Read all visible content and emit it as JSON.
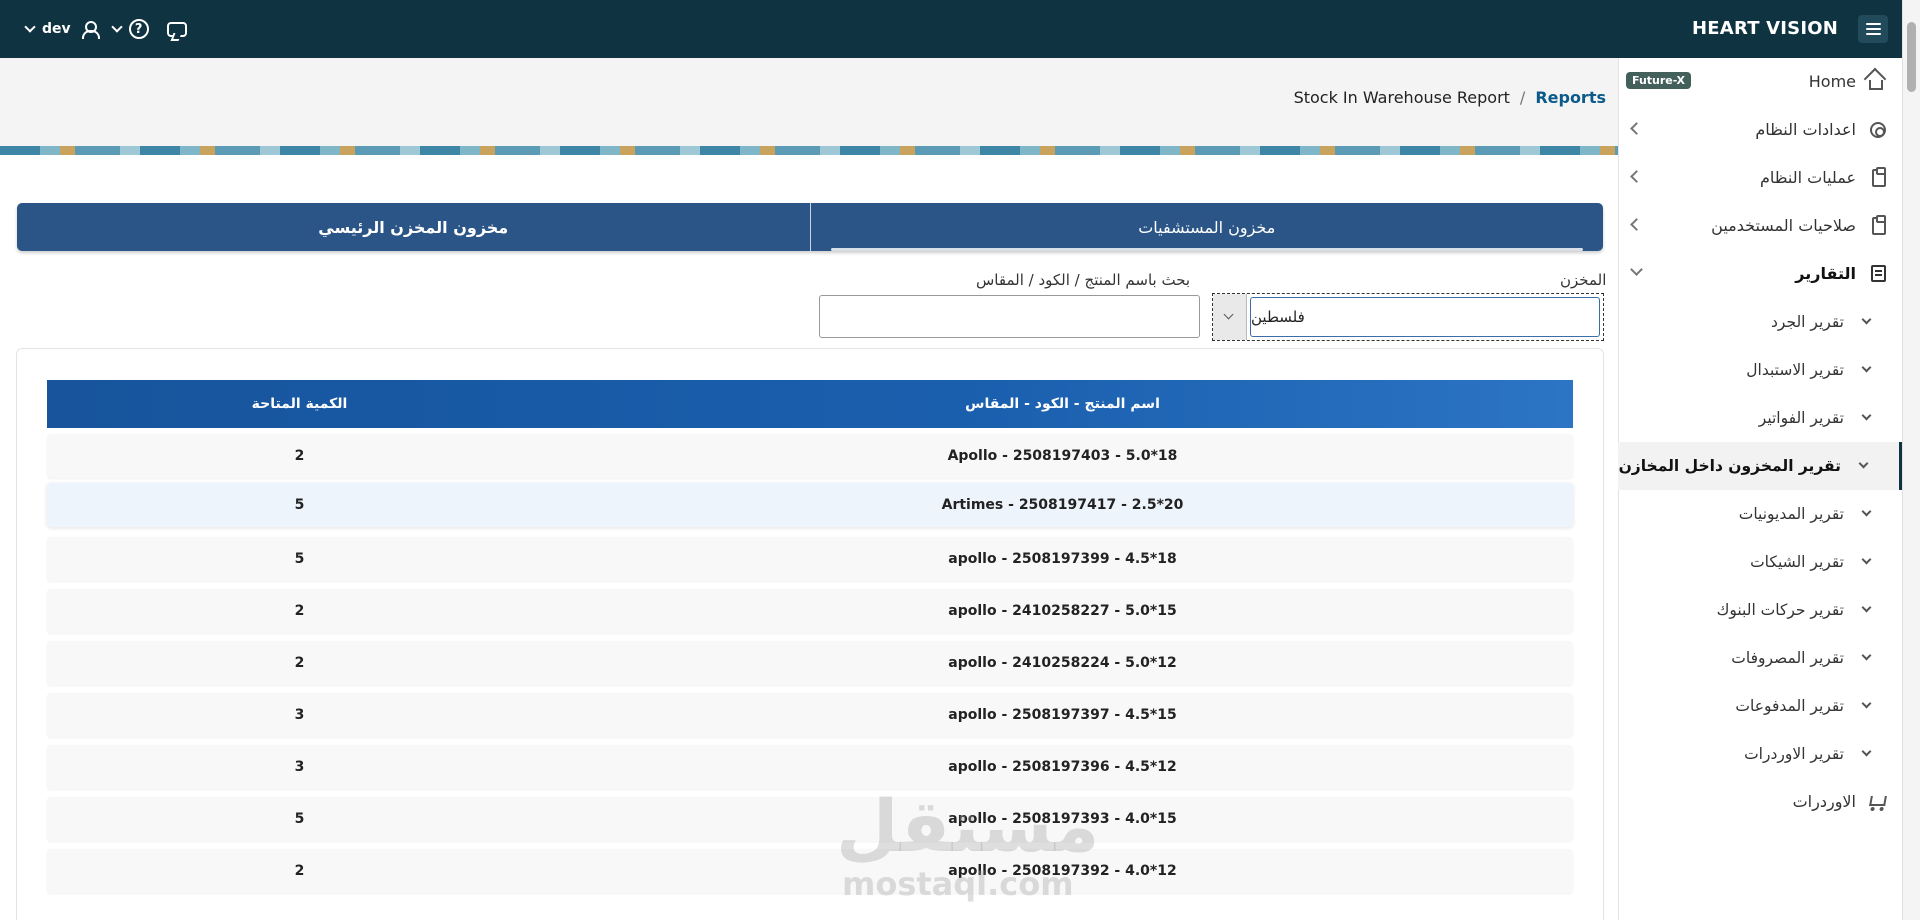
{
  "topbar": {
    "brand": "HEART VISION",
    "user": "dev"
  },
  "breadcrumb": {
    "current": "Stock In Warehouse Report",
    "separator": "/",
    "parent": "Reports"
  },
  "sidebar": {
    "badge": "Future-X",
    "items": [
      {
        "label": "Home",
        "icon": "home-icon"
      },
      {
        "label": "اعدادات النظام",
        "icon": "gear-icon"
      },
      {
        "label": "عمليات النظام",
        "icon": "clipboard-icon"
      },
      {
        "label": "صلاحيات المستخدمين",
        "icon": "clipboard-lock-icon"
      },
      {
        "label": "التقارير",
        "icon": "report-icon"
      }
    ],
    "reports": [
      "تقرير الجرد",
      "تقرير الاستبدال",
      "تقرير الفواتير",
      "تقرير المخزون داخل المخازن",
      "تقرير المديونيات",
      "تقرير الشيكات",
      "تقرير حركات البنوك",
      "تقرير المصروفات",
      "تقرير المدفوعات",
      "تقرير الاوردرات"
    ],
    "orders": {
      "label": "الاوردرات",
      "icon": "cart-icon"
    }
  },
  "tabs": {
    "hospitals": "مخزون المستشفيات",
    "main_store": "مخزون المخزن الرئيسي"
  },
  "filters": {
    "store_label": "المخزن",
    "store_value": "فلسطين",
    "search_label": "بحث باسم المنتج / الكود / المقاس",
    "search_value": ""
  },
  "table": {
    "headers": {
      "name": "اسم المنتج - الكود - المقاس",
      "qty": "الكمية المتاحة"
    },
    "rows": [
      {
        "name": "Apollo - 2508197403 - 5.0*18",
        "qty": "2"
      },
      {
        "name": "Artimes - 2508197417 - 2.5*20",
        "qty": "5"
      },
      {
        "name": "apollo - 2508197399 - 4.5*18",
        "qty": "5"
      },
      {
        "name": "apollo - 2410258227 - 5.0*15",
        "qty": "2"
      },
      {
        "name": "apollo - 2410258224 - 5.0*12",
        "qty": "2"
      },
      {
        "name": "apollo - 2508197397 - 4.5*15",
        "qty": "3"
      },
      {
        "name": "apollo - 2508197396 - 4.5*12",
        "qty": "3"
      },
      {
        "name": "apollo - 2508197393 - 4.0*15",
        "qty": "5"
      },
      {
        "name": "apollo - 2508197392 - 4.0*12",
        "qty": "2"
      }
    ]
  },
  "watermark": {
    "arabic": "مستقل",
    "latin": "mostaql.com"
  }
}
